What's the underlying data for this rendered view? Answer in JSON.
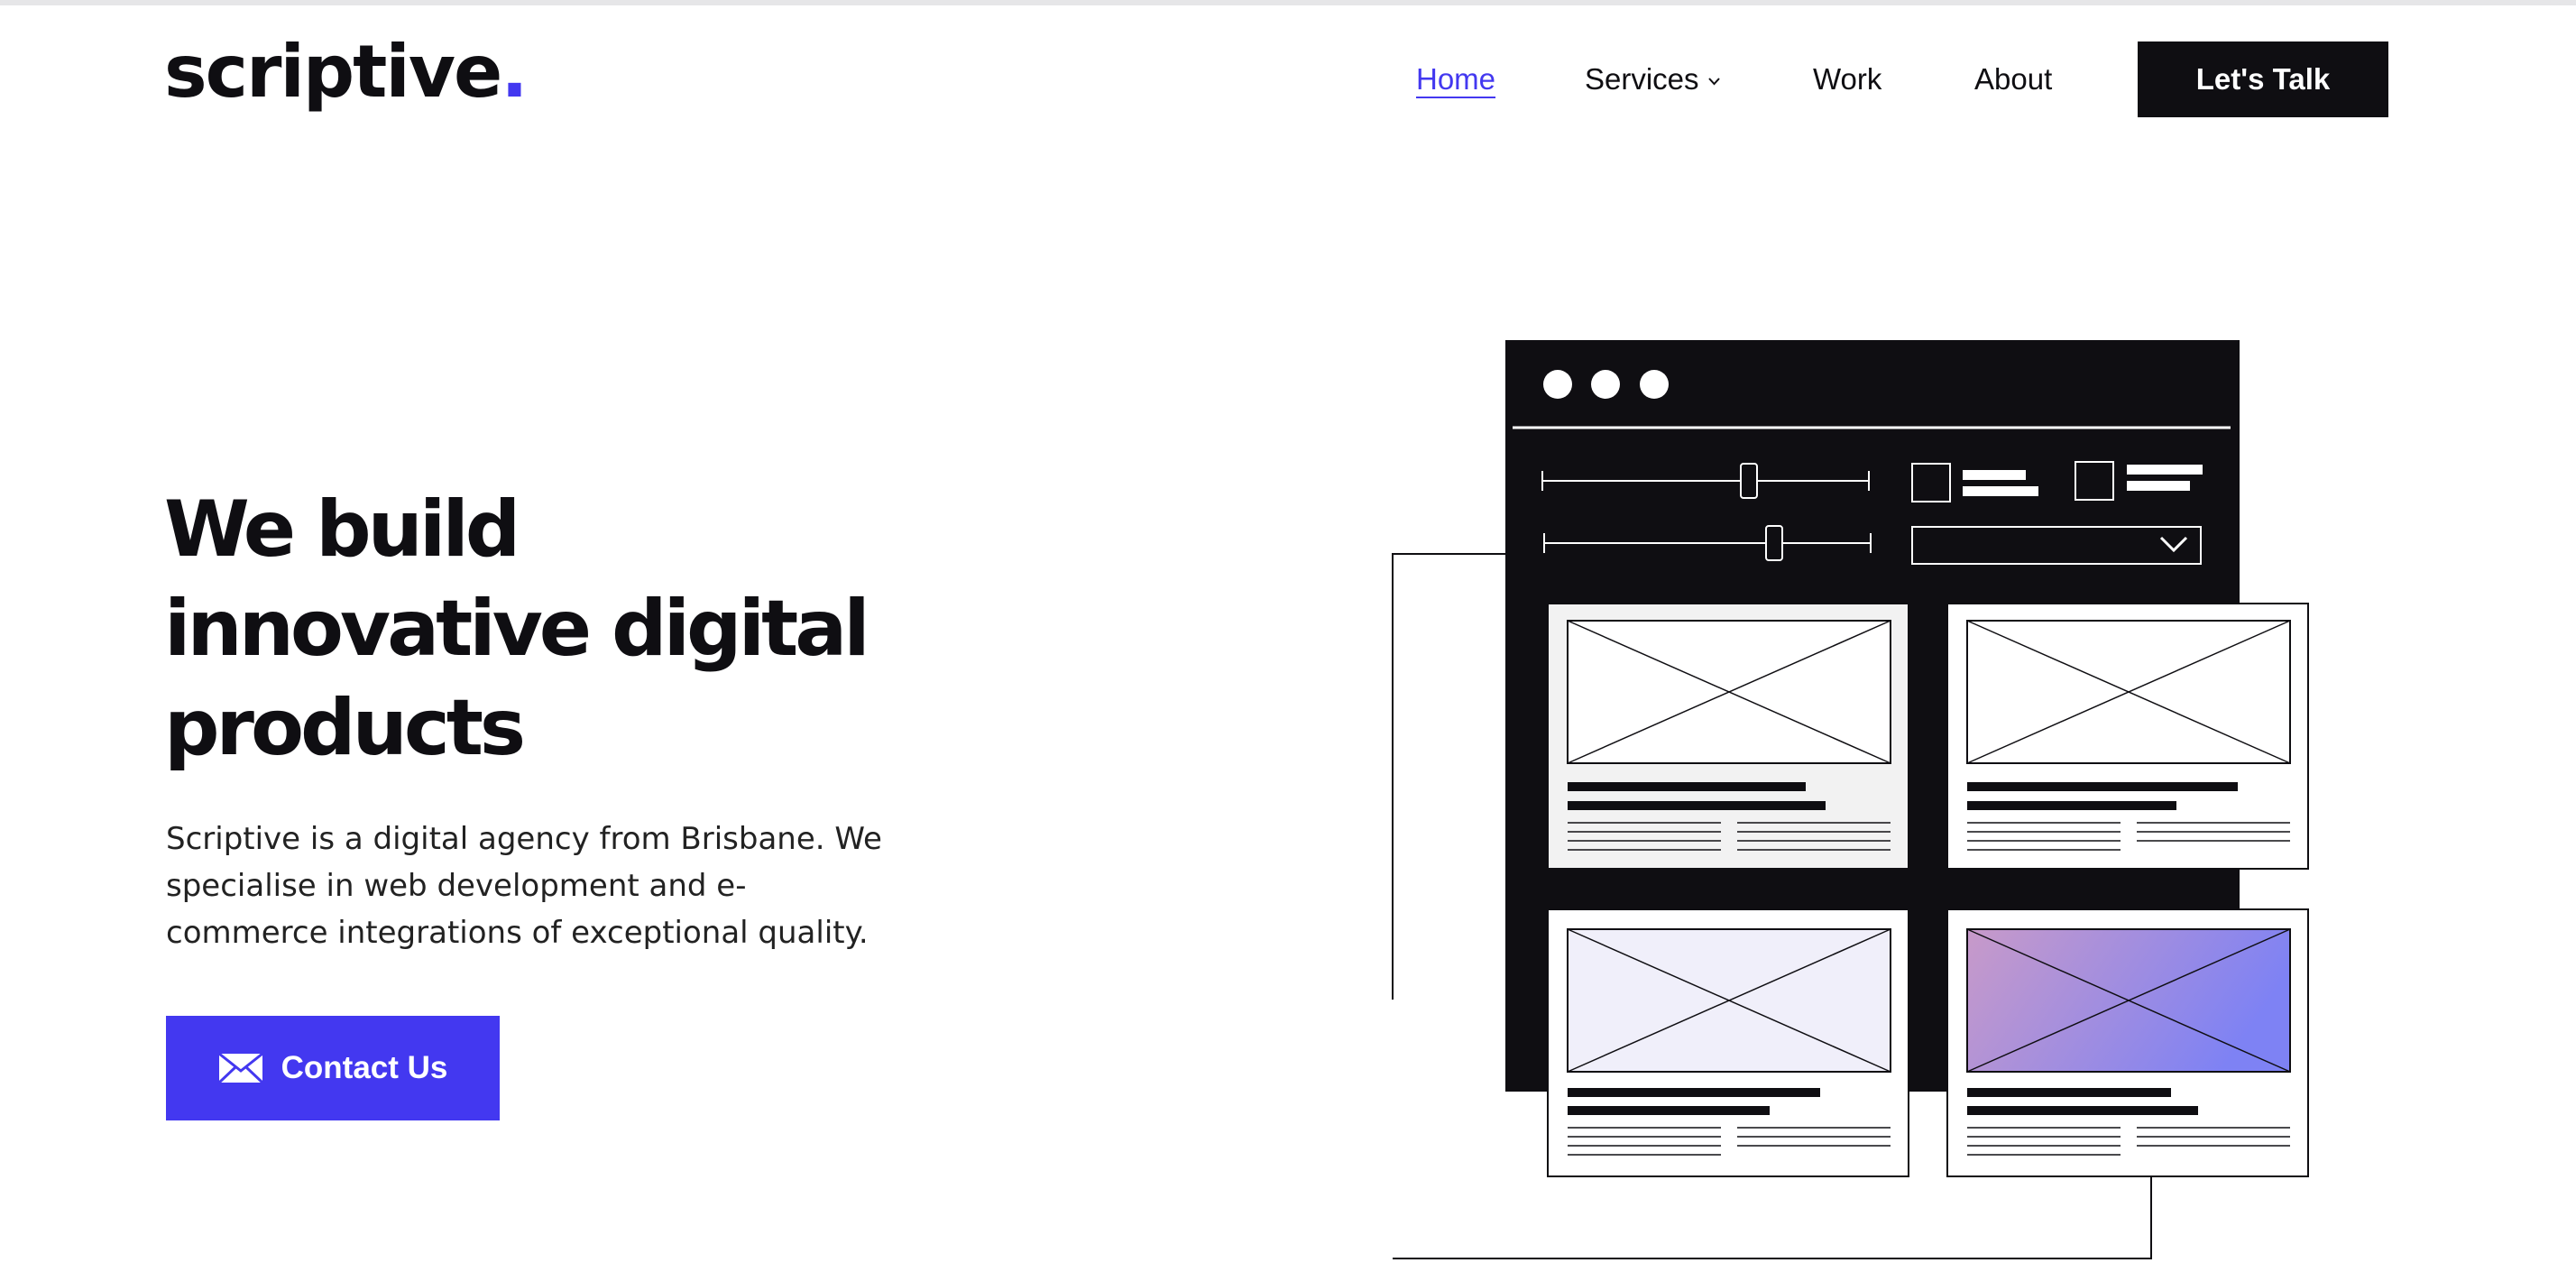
{
  "header": {
    "logo_text": "scriptive",
    "logo_dot": ".",
    "nav": [
      {
        "label": "Home",
        "active": true
      },
      {
        "label": "Services",
        "has_dropdown": true
      },
      {
        "label": "Work"
      },
      {
        "label": "About"
      }
    ],
    "cta_label": "Let's Talk"
  },
  "hero": {
    "title_lines": [
      "We build",
      "innovative digital",
      "products"
    ],
    "description": "Scriptive is a digital agency from Brisbane. We specialise in web development and e-commerce integrations of exceptional quality.",
    "button_label": "Contact Us",
    "button_icon": "mail-icon"
  },
  "colors": {
    "accent": "#4338f0",
    "dark": "#0f0e12",
    "background": "#ffffff",
    "gradient_start": "#c89ac9",
    "gradient_end": "#7e82f4",
    "tint": "#f0effa"
  }
}
